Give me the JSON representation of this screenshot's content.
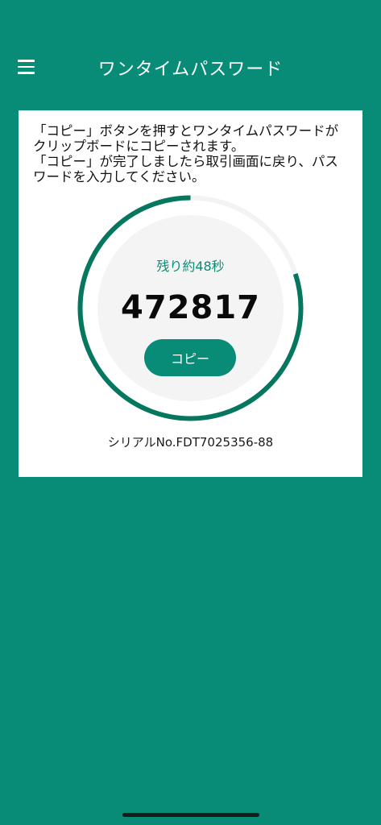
{
  "header": {
    "title": "ワンタイムパスワード",
    "menu_icon": "hamburger-menu-icon"
  },
  "instructions": {
    "line1": "「コピー」ボタンを押すとワンタイムパスワードがクリップボードにコピーされます。",
    "line2": "「コピー」が完了しましたら取引画面に戻り、パスワードを入力してください。"
  },
  "timer": {
    "remaining_label": "残り約48秒",
    "progress_fraction": 0.8,
    "otp_code": "472817",
    "copy_label": "コピー"
  },
  "serial": {
    "text": "シリアルNo.FDT7025356-88"
  },
  "colors": {
    "background": "#088c77",
    "accent": "#088c77",
    "ring_progress": "#06775f",
    "ring_track": "#f3f3f3",
    "label_text": "#0d8b74"
  }
}
